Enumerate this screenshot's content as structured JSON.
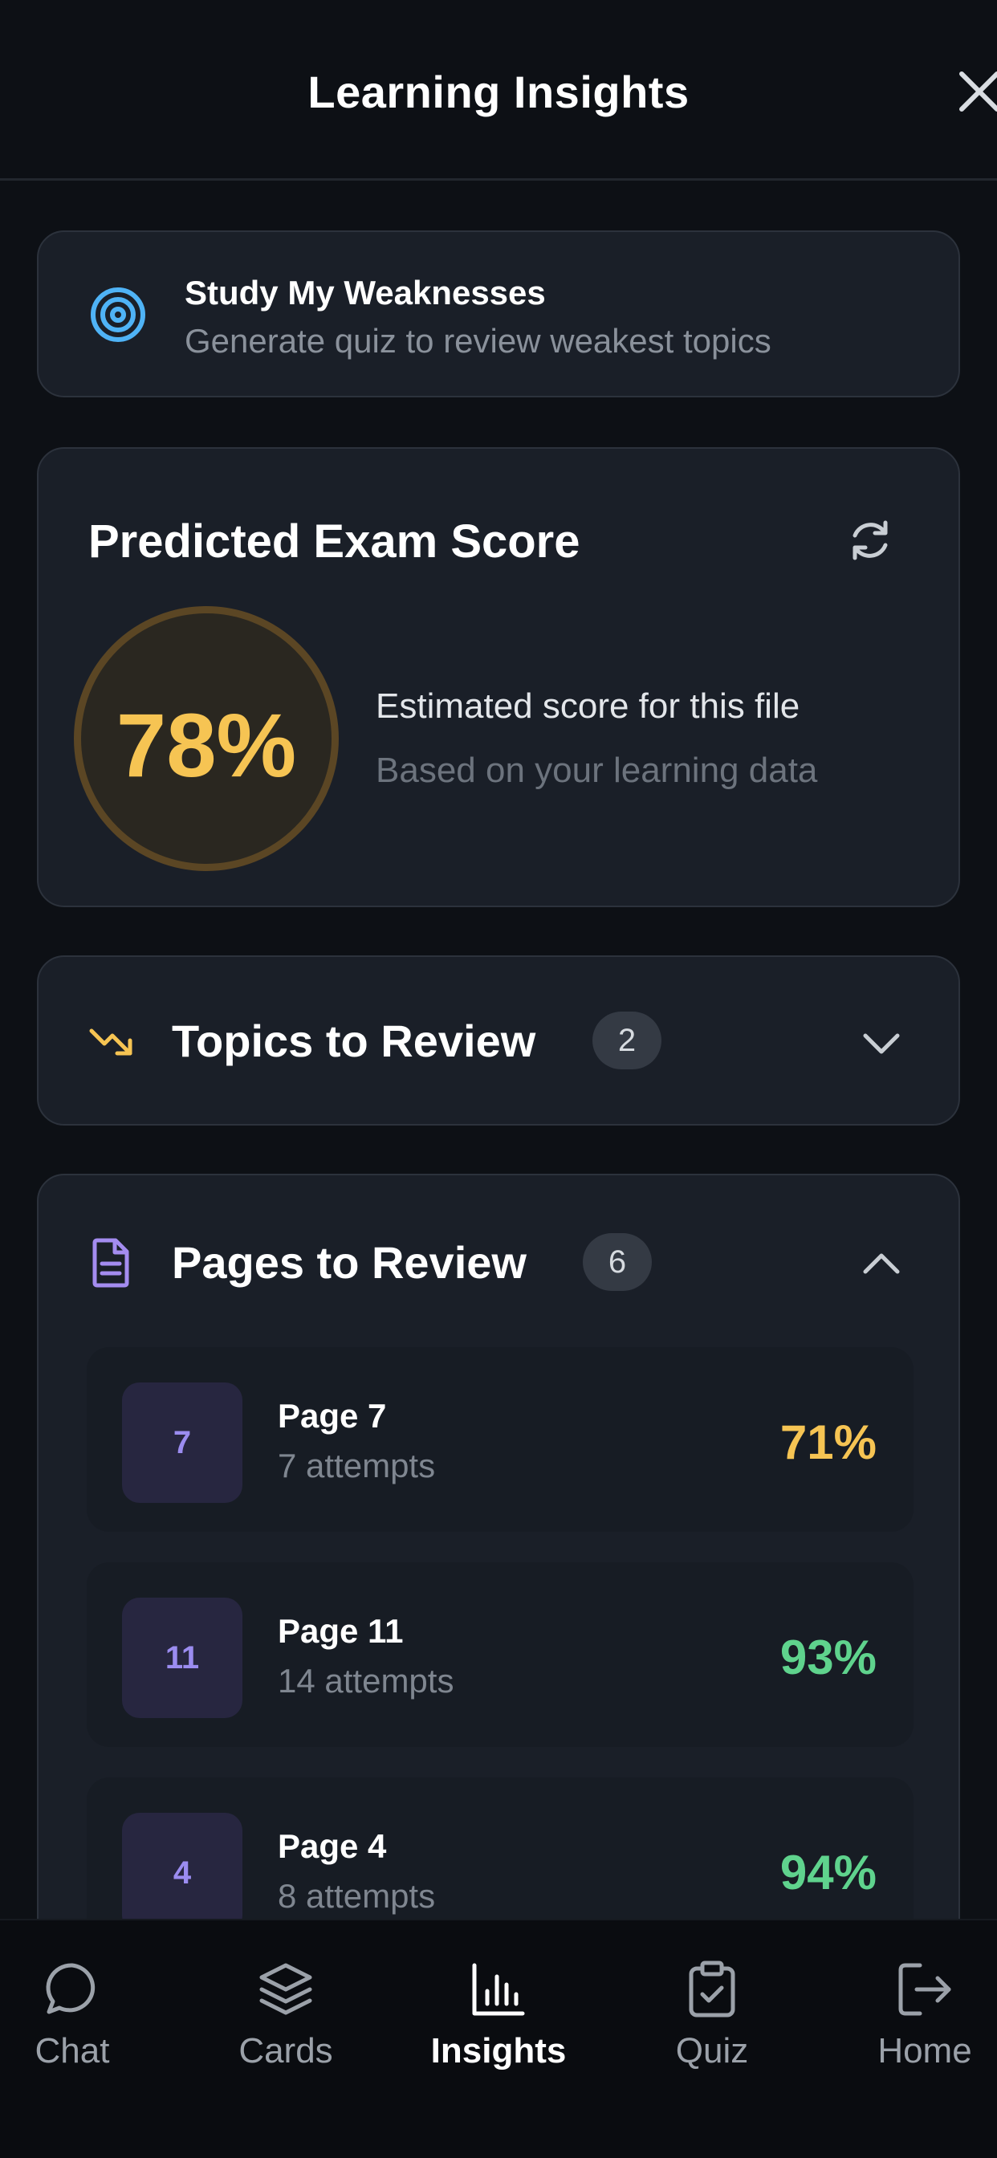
{
  "header": {
    "title": "Learning Insights"
  },
  "weakness": {
    "title": "Study My Weaknesses",
    "subtitle": "Generate quiz to review weakest topics"
  },
  "score": {
    "title": "Predicted Exam Score",
    "value": "78%",
    "line1": "Estimated score for this file",
    "line2": "Based on your learning data"
  },
  "topics": {
    "title": "Topics to Review",
    "count": "2"
  },
  "pages": {
    "title": "Pages to Review",
    "count": "6",
    "items": [
      {
        "num": "7",
        "name": "Page 7",
        "attempts": "7 attempts",
        "pct": "71%",
        "color": "#f6c453"
      },
      {
        "num": "11",
        "name": "Page 11",
        "attempts": "14 attempts",
        "pct": "93%",
        "color": "#5fd38d"
      },
      {
        "num": "4",
        "name": "Page 4",
        "attempts": "8 attempts",
        "pct": "94%",
        "color": "#5fd38d"
      }
    ]
  },
  "nav": {
    "items": [
      {
        "label": "Chat",
        "icon": "chat-bubble-icon"
      },
      {
        "label": "Cards",
        "icon": "layers-icon"
      },
      {
        "label": "Insights",
        "icon": "bar-chart-icon",
        "active": true
      },
      {
        "label": "Quiz",
        "icon": "clipboard-check-icon"
      },
      {
        "label": "Home",
        "icon": "log-out-icon"
      }
    ]
  },
  "colors": {
    "accent_amber": "#f6c453",
    "accent_green": "#5fd38d",
    "accent_purple": "#9b8cf0",
    "accent_blue": "#4fb3f6"
  }
}
